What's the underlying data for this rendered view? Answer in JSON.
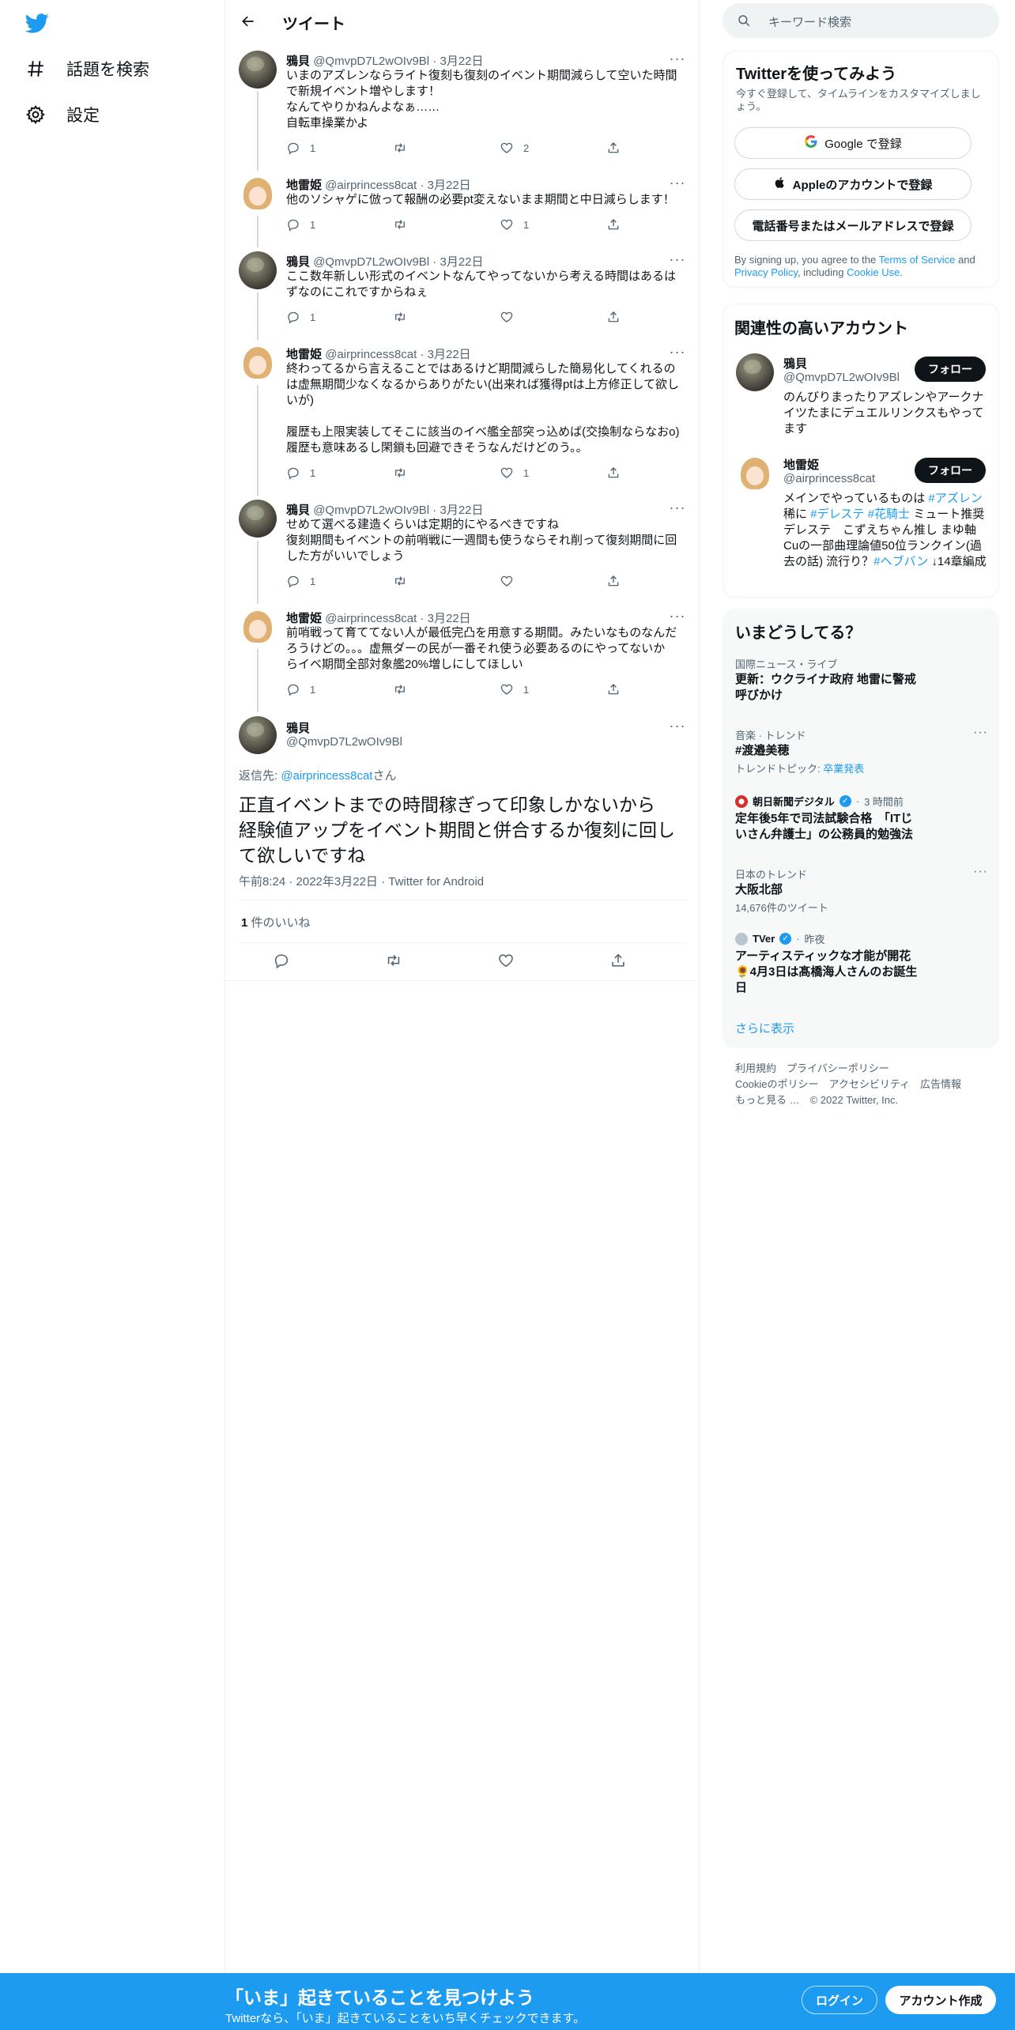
{
  "nav": {
    "logo": "twitter-bird-icon",
    "items": [
      {
        "label": "話題を検索",
        "icon": "hashtag-icon"
      },
      {
        "label": "設定",
        "icon": "gear-icon"
      }
    ]
  },
  "header": {
    "title": "ツイート"
  },
  "tweets": [
    {
      "name": "鴉貝",
      "handle": "@QmvpD7L2wOIv9Bl",
      "date": "3月22日",
      "text": "いまのアズレンならライト復刻も復刻のイベント期間減らして空いた時間\nで新規イベント増やします！\nなんてやりかねんよなぁ……\n自転車操業かよ",
      "replies": "1",
      "retweets": "",
      "likes": "2"
    },
    {
      "name": "地雷姫",
      "handle": "@airprincess8cat",
      "date": "3月22日",
      "text": "他のソシャゲに倣って報酬の必要pt変えないまま期間と中日減らします！",
      "replies": "1",
      "retweets": "",
      "likes": "1"
    },
    {
      "name": "鴉貝",
      "handle": "@QmvpD7L2wOIv9Bl",
      "date": "3月22日",
      "text": "ここ数年新しい形式のイベントなんてやってないから考える時間はあるは\nずなのにこれですからねぇ",
      "replies": "1",
      "retweets": "",
      "likes": ""
    },
    {
      "name": "地雷姫",
      "handle": "@airprincess8cat",
      "date": "3月22日",
      "text": "終わってるから言えることではあるけど期間減らした簡易化してくれるの\nは虚無期間少なくなるからありがたい(出来れば獲得ptは上方修正して欲し\nいが)\n\n履歴も上限実装してそこに該当のイベ艦全部突っ込めば(交換制ならなおo)\n履歴も意味あるし閑鎖も回避できそうなんだけどのう。。",
      "replies": "1",
      "retweets": "",
      "likes": "1"
    },
    {
      "name": "鴉貝",
      "handle": "@QmvpD7L2wOIv9Bl",
      "date": "3月22日",
      "text": "せめて選べる建造くらいは定期的にやるべきですね\n復刻期間もイベントの前哨戦に一週間も使うならそれ削って復刻期間に回\nした方がいいでしょう",
      "replies": "1",
      "retweets": "",
      "likes": ""
    },
    {
      "name": "地雷姫",
      "handle": "@airprincess8cat",
      "date": "3月22日",
      "text": "前哨戦って育ててない人が最低完凸を用意する期間。みたいなものなんだ\nろうけどの。。。虚無ダーの民が一番それ使う必要あるのにやってないか\nらイベ期間全部対象艦20%増しにしてほしい",
      "replies": "1",
      "retweets": "",
      "likes": "1"
    }
  ],
  "focused": {
    "name": "鴉貝",
    "handle": "@QmvpD7L2wOIv9Bl",
    "reply_prefix": "返信先: ",
    "reply_to": "@airprincess8cat",
    "reply_suffix": "さん",
    "text": "正直イベントまでの時間稼ぎって印象しかないから\n経験値アップをイベント期間と併合するか復刻に回し\nて欲しいですね",
    "meta": "午前8:24 · 2022年3月22日 · Twitter for Android",
    "likes_count": "1",
    "likes_label": " 件のいいね"
  },
  "search": {
    "placeholder": "キーワード検索"
  },
  "signup": {
    "title": "Twitterを使ってみよう",
    "subtitle": "今すぐ登録して、タイムラインをカスタマイズしましょう。",
    "google": "Google で登録",
    "apple": "Appleのアカウントで登録",
    "phone": "電話番号またはメールアドレスで登録",
    "legal_1": "By signing up, you agree to the ",
    "terms": "Terms of Service",
    "legal_2": " and ",
    "privacy": "Privacy Policy",
    "legal_3": ", including ",
    "cookie": "Cookie Use",
    "legal_4": "."
  },
  "related": {
    "title": "関連性の高いアカウント",
    "follow": "フォロー",
    "accounts": [
      {
        "name": "鴉貝",
        "handle": "@QmvpD7L2wOIv9Bl",
        "bio": "のんびりまったりアズレンやアークナイツたまにデュエルリンクスもやってます"
      },
      {
        "name": "地雷姫",
        "handle": "@airprincess8cat",
        "bio_1": "メインでやっているものは ",
        "bio_tag1": "#アズレン",
        "bio_2": " 稀に ",
        "bio_tag2": "#デレステ",
        "bio_3": " ",
        "bio_tag3": "#花騎士",
        "bio_4": " ミュート推奨 デレステ　こずえちゃん推し まゆ軸Cuの一部曲理論値50位ランクイン(過去の話) 流行り？",
        "bio_tag4": "#ヘブバン",
        "bio_5": " ↓14章編成"
      }
    ]
  },
  "trends": {
    "title": "いまどうしてる？",
    "items": [
      {
        "context": "国際ニュース・ライブ",
        "title": "更新：ウクライナ政府 地雷に警戒\n呼びかけ"
      },
      {
        "context": "音楽 · トレンド",
        "title": "#渡邉美穂",
        "sub_label": "トレンドトピック: ",
        "sub_link": "卒業発表"
      },
      {
        "source": "朝日新聞デジタル",
        "time": "3 時間前",
        "title": "定年後5年で司法試験合格　「ITじ\nいさん弁護士」の公務員的勉強法"
      },
      {
        "context": "日本のトレンド",
        "title": "大阪北部",
        "sub": "14,676件のツイート"
      },
      {
        "source": "TVer",
        "time": "昨夜",
        "title": "アーティスティックな才能が開花\n🌻4月3日は髙橋海人さんのお誕生\n日"
      }
    ],
    "show_more": "さらに表示"
  },
  "footer": {
    "line1": "利用規約　プライバシーポリシー",
    "line2": "Cookieのポリシー　アクセシビリティ　広告情報",
    "line3": "もっと見る …　© 2022 Twitter, Inc."
  },
  "banner": {
    "title": "「いま」起きていることを見つけよう",
    "subtitle": "Twitterなら、「いま」起きていることをいち早くチェックできます。",
    "login": "ログイン",
    "signup": "アカウント作成"
  },
  "colors": {
    "accent": "#1d9bf0",
    "text": "#0f1419",
    "muted": "#536471"
  }
}
